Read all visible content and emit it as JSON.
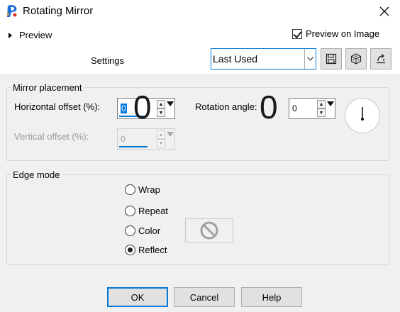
{
  "window": {
    "title": "Rotating Mirror",
    "close_icon": "close-icon",
    "app_icon": "paintshop-pro-icon"
  },
  "top": {
    "preview_label": "Preview",
    "preview_on_image_label": "Preview on Image",
    "preview_on_image_checked": true,
    "settings_label": "Settings",
    "preset_value": "Last Used",
    "toolbar_icons": [
      "save-preset-icon",
      "random-dice-icon",
      "reset-default-icon"
    ]
  },
  "mirror_placement": {
    "title": "Mirror placement",
    "horizontal_label": "Horizontal offset (%):",
    "horizontal_value": "0",
    "horizontal_big_value": "0",
    "rotation_label": "Rotation angle:",
    "rotation_big_value": "0",
    "rotation_value": "0",
    "vertical_label": "Vertical offset (%):",
    "vertical_value": "0"
  },
  "edge_mode": {
    "title": "Edge mode",
    "options": [
      {
        "label": "Wrap",
        "selected": false
      },
      {
        "label": "Repeat",
        "selected": false
      },
      {
        "label": "Color",
        "selected": false
      },
      {
        "label": "Reflect",
        "selected": true
      }
    ]
  },
  "buttons": {
    "ok": "OK",
    "cancel": "Cancel",
    "help": "Help"
  },
  "colors": {
    "accent": "#0078d7",
    "panel": "#f0f0f0"
  }
}
